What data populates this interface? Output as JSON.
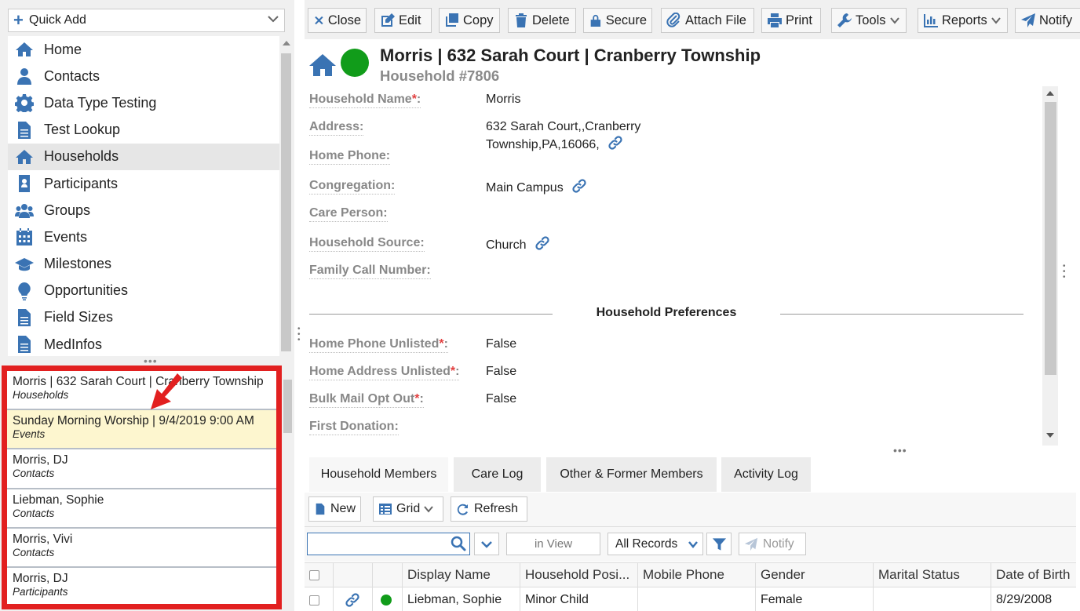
{
  "quick_add": {
    "label": "Quick Add"
  },
  "nav": {
    "items": [
      {
        "label": "Home",
        "icon": "home-icon"
      },
      {
        "label": "Contacts",
        "icon": "person-icon"
      },
      {
        "label": "Data Type Testing",
        "icon": "gear-icon"
      },
      {
        "label": "Test Lookup",
        "icon": "document-icon"
      },
      {
        "label": "Households",
        "icon": "home-icon"
      },
      {
        "label": "Participants",
        "icon": "id-badge-icon"
      },
      {
        "label": "Groups",
        "icon": "group-icon"
      },
      {
        "label": "Events",
        "icon": "calendar-icon"
      },
      {
        "label": "Milestones",
        "icon": "graduation-cap-icon"
      },
      {
        "label": "Opportunities",
        "icon": "lightbulb-icon"
      },
      {
        "label": "Field Sizes",
        "icon": "document-icon"
      },
      {
        "label": "MedInfos",
        "icon": "document-icon"
      }
    ],
    "active": "Households"
  },
  "recent": {
    "items": [
      {
        "title": "Morris | 632 Sarah Court | Cranberry Township",
        "subtitle": "Households"
      },
      {
        "title": "Sunday Morning Worship | 9/4/2019 9:00 AM",
        "subtitle": "Events"
      },
      {
        "title": "Morris, DJ",
        "subtitle": "Contacts"
      },
      {
        "title": "Liebman, Sophie",
        "subtitle": "Contacts"
      },
      {
        "title": "Morris, Vivi",
        "subtitle": "Contacts"
      },
      {
        "title": "Morris, DJ",
        "subtitle": "Participants"
      }
    ]
  },
  "toolbar": {
    "close": "Close",
    "edit": "Edit",
    "copy": "Copy",
    "delete": "Delete",
    "secure": "Secure",
    "attach": "Attach File",
    "print": "Print",
    "tools": "Tools",
    "reports": "Reports",
    "notify": "Notify"
  },
  "record": {
    "title": "Morris | 632 Sarah Court | Cranberry Township",
    "subtitle": "Household #7806",
    "status_color": "#119c1a"
  },
  "fields": {
    "household_name": {
      "label": "Household Name",
      "value": "Morris"
    },
    "address": {
      "label": "Address:",
      "line1": "632 Sarah Court,,Cranberry",
      "line2": "Township,PA,16066,"
    },
    "home_phone": {
      "label": "Home Phone:"
    },
    "congregation": {
      "label": "Congregation:",
      "value": "Main Campus"
    },
    "care_person": {
      "label": "Care Person:"
    },
    "household_source": {
      "label": "Household Source:",
      "value": "Church"
    },
    "family_call_number": {
      "label": "Family Call Number:"
    },
    "section": "Household Preferences",
    "home_phone_unlisted": {
      "label": "Home Phone Unlisted",
      "value": "False"
    },
    "home_address_unlisted": {
      "label": "Home Address Unlisted",
      "value": "False"
    },
    "bulk_mail_opt_out": {
      "label": "Bulk Mail Opt Out",
      "value": "False"
    },
    "first_donation": {
      "label": "First Donation:"
    }
  },
  "tabs": [
    {
      "label": "Household Members"
    },
    {
      "label": "Care Log"
    },
    {
      "label": "Other & Former Members"
    },
    {
      "label": "Activity Log"
    }
  ],
  "subtoolbar": {
    "new": "New",
    "grid": "Grid",
    "refresh": "Refresh"
  },
  "filter": {
    "search_value": "",
    "in_view": "in View",
    "records": "All Records",
    "notify": "Notify"
  },
  "grid": {
    "columns": [
      "Display Name",
      "Household Posi...",
      "Mobile Phone",
      "Gender",
      "Marital Status",
      "Date of Birth"
    ],
    "rows": [
      {
        "display_name": "Liebman, Sophie",
        "household_position": "Minor Child",
        "mobile_phone": "",
        "gender": "Female",
        "marital_status": "",
        "date_of_birth": "8/29/2008"
      }
    ]
  },
  "colors": {
    "accent": "#3a73b3",
    "highlight_border": "#e22020",
    "selected_recent": "#fdf6cf",
    "status_green": "#119c1a"
  }
}
